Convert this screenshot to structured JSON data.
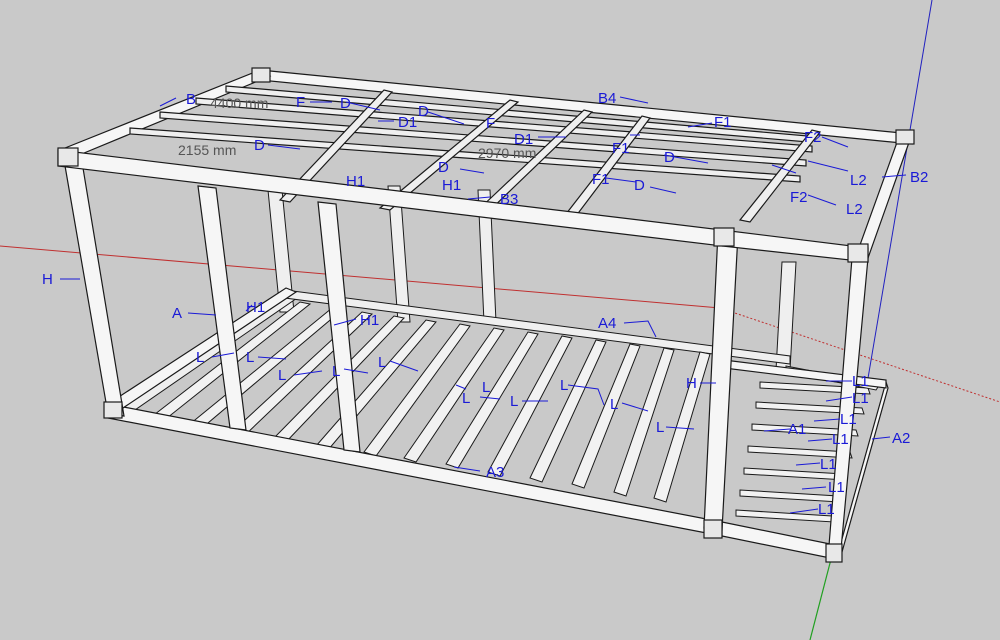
{
  "title": "",
  "colors": {
    "background": "#c9c9c9",
    "beam_fill": "#f4f4f4",
    "beam_stroke": "#1a1a1a",
    "label": "#1a1ad6",
    "axis_red": "#c03030",
    "axis_green": "#20a020",
    "axis_blue": "#2020c0"
  },
  "dimensions": {
    "top_left": "2155 mm",
    "top_center": "2970 mm",
    "top_back": "4400 mm"
  },
  "labels": {
    "h_left": "H",
    "a_left": "A",
    "h1_a": "H1",
    "h1_b": "H1",
    "h1_c": "H1",
    "h1_d": "H1",
    "h_right": "H",
    "a1": "A1",
    "a2": "A2",
    "a3": "A3",
    "a4": "A4",
    "b_top": "B",
    "b2": "B2",
    "b3": "B3",
    "b4": "B4",
    "f_a": "F",
    "f_b": "F",
    "f1_a": "F1",
    "f1_b": "F1",
    "f1_c": "F1",
    "f2_a": "F2",
    "f2_b": "F2",
    "d_a": "D",
    "d_b": "D",
    "d_c": "D",
    "d_d": "D",
    "d_e": "D",
    "d_f": "D",
    "d1_a": "D1",
    "d1_b": "D1",
    "l_1": "L",
    "l_2": "L",
    "l_3": "L",
    "l_4": "L",
    "l_5": "L",
    "l_6": "L",
    "l_7": "L",
    "l_8": "L",
    "l_9": "L",
    "l_10": "L",
    "l_11": "L",
    "l1_1": "L1",
    "l1_2": "L1",
    "l1_3": "L1",
    "l1_4": "L1",
    "l1_5": "L1",
    "l1_6": "L1",
    "l1_7": "L1",
    "l2_1": "L2",
    "l2_2": "L2"
  }
}
